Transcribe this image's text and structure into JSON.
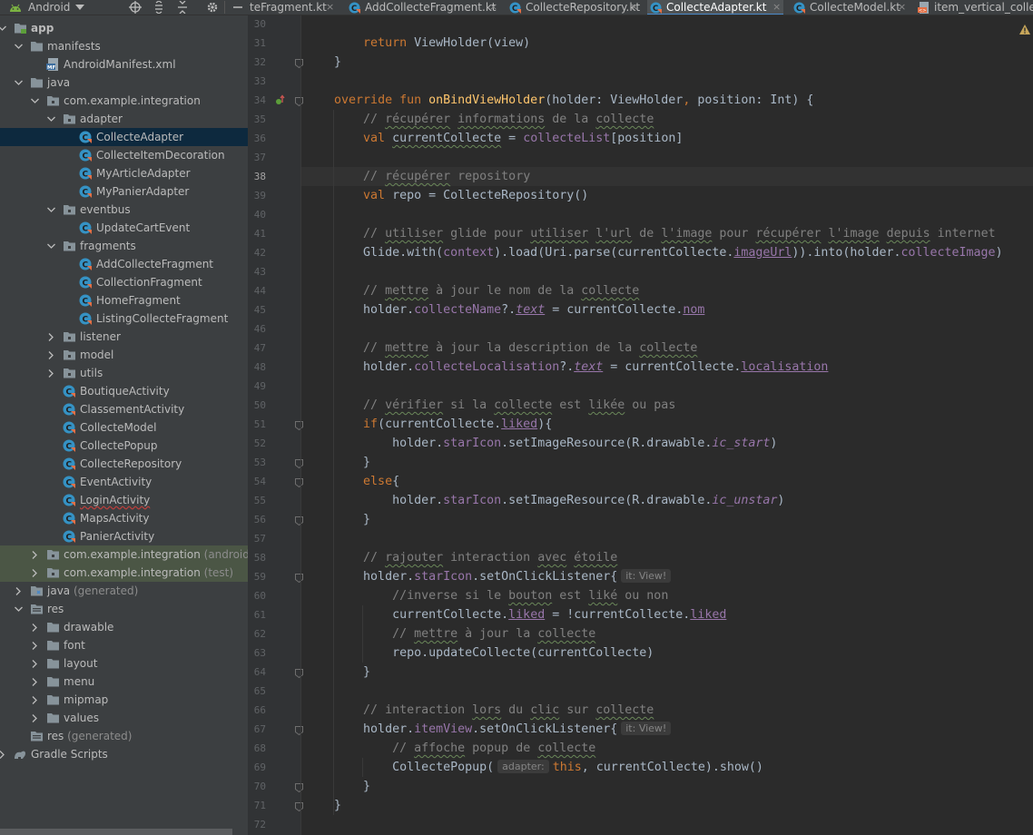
{
  "project_panel": {
    "view_mode": "Android",
    "tree": [
      {
        "label": "app",
        "depth": 0,
        "icon": "module-folder-icon",
        "expanded": true,
        "bold": true
      },
      {
        "label": "manifests",
        "depth": 1,
        "icon": "folder-icon",
        "expanded": true
      },
      {
        "label": "AndroidManifest.xml",
        "depth": 2,
        "icon": "manifest-file-icon"
      },
      {
        "label": "java",
        "depth": 1,
        "icon": "folder-icon",
        "expanded": true
      },
      {
        "label": "com.example.integration",
        "depth": 2,
        "icon": "package-icon",
        "expanded": true
      },
      {
        "label": "adapter",
        "depth": 3,
        "icon": "package-icon",
        "expanded": true
      },
      {
        "label": "CollecteAdapter",
        "depth": 4,
        "icon": "kotlin-class-icon",
        "selected": true
      },
      {
        "label": "CollecteItemDecoration",
        "depth": 4,
        "icon": "kotlin-class-icon"
      },
      {
        "label": "MyArticleAdapter",
        "depth": 4,
        "icon": "kotlin-class-icon"
      },
      {
        "label": "MyPanierAdapter",
        "depth": 4,
        "icon": "kotlin-class-icon"
      },
      {
        "label": "eventbus",
        "depth": 3,
        "icon": "package-icon",
        "expanded": true
      },
      {
        "label": "UpdateCartEvent",
        "depth": 4,
        "icon": "kotlin-class-icon"
      },
      {
        "label": "fragments",
        "depth": 3,
        "icon": "package-icon",
        "expanded": true
      },
      {
        "label": "AddCollecteFragment",
        "depth": 4,
        "icon": "kotlin-class-icon"
      },
      {
        "label": "CollectionFragment",
        "depth": 4,
        "icon": "kotlin-class-icon"
      },
      {
        "label": "HomeFragment",
        "depth": 4,
        "icon": "kotlin-class-icon"
      },
      {
        "label": "ListingCollecteFragment",
        "depth": 4,
        "icon": "kotlin-class-icon"
      },
      {
        "label": "listener",
        "depth": 3,
        "icon": "package-icon",
        "expanded": false
      },
      {
        "label": "model",
        "depth": 3,
        "icon": "package-icon",
        "expanded": false
      },
      {
        "label": "utils",
        "depth": 3,
        "icon": "package-icon",
        "expanded": false
      },
      {
        "label": "BoutiqueActivity",
        "depth": 3,
        "icon": "kotlin-class-icon"
      },
      {
        "label": "ClassementActivity",
        "depth": 3,
        "icon": "kotlin-class-icon"
      },
      {
        "label": "CollecteModel",
        "depth": 3,
        "icon": "kotlin-class-icon"
      },
      {
        "label": "CollectePopup",
        "depth": 3,
        "icon": "kotlin-class-icon"
      },
      {
        "label": "CollecteRepository",
        "depth": 3,
        "icon": "kotlin-class-icon"
      },
      {
        "label": "EventActivity",
        "depth": 3,
        "icon": "kotlin-class-icon"
      },
      {
        "label": "LoginActivity",
        "depth": 3,
        "icon": "kotlin-class-icon",
        "error": true
      },
      {
        "label": "MapsActivity",
        "depth": 3,
        "icon": "kotlin-class-icon"
      },
      {
        "label": "PanierActivity",
        "depth": 3,
        "icon": "kotlin-class-icon"
      },
      {
        "label": "com.example.integration",
        "suffix": "(androidTe",
        "depth": 2,
        "icon": "package-icon",
        "expanded": false,
        "highlight": true
      },
      {
        "label": "com.example.integration",
        "suffix": "(test)",
        "depth": 2,
        "icon": "package-icon",
        "expanded": false,
        "highlight": true
      },
      {
        "label": "java",
        "suffix": "(generated)",
        "depth": 1,
        "icon": "generated-folder-icon",
        "expanded": false
      },
      {
        "label": "res",
        "depth": 1,
        "icon": "res-folder-icon",
        "expanded": true
      },
      {
        "label": "drawable",
        "depth": 2,
        "icon": "folder-icon",
        "expanded": false
      },
      {
        "label": "font",
        "depth": 2,
        "icon": "folder-icon",
        "expanded": false
      },
      {
        "label": "layout",
        "depth": 2,
        "icon": "folder-icon",
        "expanded": false
      },
      {
        "label": "menu",
        "depth": 2,
        "icon": "folder-icon",
        "expanded": false
      },
      {
        "label": "mipmap",
        "depth": 2,
        "icon": "folder-icon",
        "expanded": false
      },
      {
        "label": "values",
        "depth": 2,
        "icon": "folder-icon",
        "expanded": false
      },
      {
        "label": "res",
        "suffix": "(generated)",
        "depth": 1,
        "icon": "res-folder-icon"
      },
      {
        "label": "Gradle Scripts",
        "depth": 0,
        "icon": "gradle-icon",
        "expanded": false
      }
    ]
  },
  "tabs": [
    {
      "label": "teFragment.kt",
      "icon": "kotlin-file-icon",
      "active": false
    },
    {
      "label": "AddCollecteFragment.kt",
      "icon": "kotlin-file-icon",
      "active": false
    },
    {
      "label": "CollecteRepository.kt",
      "icon": "kotlin-file-icon",
      "active": false
    },
    {
      "label": "CollecteAdapter.kt",
      "icon": "kotlin-file-icon",
      "active": true
    },
    {
      "label": "CollecteModel.kt",
      "icon": "kotlin-file-icon",
      "active": false
    },
    {
      "label": "item_vertical_collecte",
      "icon": "xml-file-icon",
      "active": false
    }
  ],
  "editor": {
    "current_line": 38,
    "lines": [
      {
        "n": 30,
        "tokens": []
      },
      {
        "n": 31,
        "tokens": [
          {
            "t": "        "
          },
          {
            "t": "return ",
            "c": "kw"
          },
          {
            "t": "ViewHolder(view)"
          }
        ]
      },
      {
        "n": 32,
        "tokens": [
          {
            "t": "    }"
          }
        ]
      },
      {
        "n": 33,
        "tokens": []
      },
      {
        "n": 34,
        "tokens": [
          {
            "t": "    "
          },
          {
            "t": "override fun ",
            "c": "kw"
          },
          {
            "t": "onBindViewHolder",
            "c": "fn"
          },
          {
            "t": "(holder: ViewHolder"
          },
          {
            "t": ", ",
            "c": "kw"
          },
          {
            "t": "position: Int) {"
          }
        ]
      },
      {
        "n": 35,
        "tokens": [
          {
            "t": "        "
          },
          {
            "t": "// ",
            "c": "cm"
          },
          {
            "t": "récupérer",
            "c": "cm typo"
          },
          {
            "t": " ",
            "c": "cm"
          },
          {
            "t": "informations",
            "c": "cm typo"
          },
          {
            "t": " de la ",
            "c": "cm"
          },
          {
            "t": "collecte",
            "c": "cm typo"
          }
        ]
      },
      {
        "n": 36,
        "tokens": [
          {
            "t": "        "
          },
          {
            "t": "val ",
            "c": "kw"
          },
          {
            "t": "currentCollecte",
            "c": "typo"
          },
          {
            "t": " = "
          },
          {
            "t": "collecteList",
            "c": "prop"
          },
          {
            "t": "[position]"
          }
        ]
      },
      {
        "n": 37,
        "tokens": []
      },
      {
        "n": 38,
        "tokens": [
          {
            "t": "        "
          },
          {
            "t": "// ",
            "c": "cm"
          },
          {
            "t": "récupérer",
            "c": "cm typo"
          },
          {
            "t": " repository",
            "c": "cm"
          }
        ]
      },
      {
        "n": 39,
        "tokens": [
          {
            "t": "        "
          },
          {
            "t": "val ",
            "c": "kw"
          },
          {
            "t": "repo = CollecteRepository()"
          }
        ]
      },
      {
        "n": 40,
        "tokens": []
      },
      {
        "n": 41,
        "tokens": [
          {
            "t": "        "
          },
          {
            "t": "// ",
            "c": "cm"
          },
          {
            "t": "utiliser",
            "c": "cm typo"
          },
          {
            "t": " glide pour ",
            "c": "cm"
          },
          {
            "t": "utiliser",
            "c": "cm typo"
          },
          {
            "t": " ",
            "c": "cm"
          },
          {
            "t": "l'url",
            "c": "cm typo"
          },
          {
            "t": " de ",
            "c": "cm"
          },
          {
            "t": "l'image",
            "c": "cm typo"
          },
          {
            "t": " pour ",
            "c": "cm"
          },
          {
            "t": "récupérer",
            "c": "cm typo"
          },
          {
            "t": " ",
            "c": "cm"
          },
          {
            "t": "l'image",
            "c": "cm typo"
          },
          {
            "t": " ",
            "c": "cm"
          },
          {
            "t": "depuis",
            "c": "cm typo"
          },
          {
            "t": " internet",
            "c": "cm"
          }
        ]
      },
      {
        "n": 42,
        "tokens": [
          {
            "t": "        "
          },
          {
            "t": "Glide.with("
          },
          {
            "t": "context",
            "c": "prop"
          },
          {
            "t": ").load(Uri.parse(currentCollecte."
          },
          {
            "t": "imageUrl",
            "c": "prop ul"
          },
          {
            "t": ")).into(holder."
          },
          {
            "t": "collecteImage",
            "c": "prop"
          },
          {
            "t": ")"
          }
        ]
      },
      {
        "n": 43,
        "tokens": []
      },
      {
        "n": 44,
        "tokens": [
          {
            "t": "        "
          },
          {
            "t": "// ",
            "c": "cm"
          },
          {
            "t": "mettre",
            "c": "cm typo"
          },
          {
            "t": " à jour le nom de la ",
            "c": "cm"
          },
          {
            "t": "collecte",
            "c": "cm typo"
          }
        ]
      },
      {
        "n": 45,
        "tokens": [
          {
            "t": "        "
          },
          {
            "t": "holder."
          },
          {
            "t": "collecteName",
            "c": "prop"
          },
          {
            "t": "?."
          },
          {
            "t": "text",
            "c": "prop ital ul"
          },
          {
            "t": " = currentCollecte."
          },
          {
            "t": "nom",
            "c": "prop ul"
          }
        ]
      },
      {
        "n": 46,
        "tokens": []
      },
      {
        "n": 47,
        "tokens": [
          {
            "t": "        "
          },
          {
            "t": "// ",
            "c": "cm"
          },
          {
            "t": "mettre",
            "c": "cm typo"
          },
          {
            "t": " à jour la description de la ",
            "c": "cm"
          },
          {
            "t": "collecte",
            "c": "cm typo"
          }
        ]
      },
      {
        "n": 48,
        "tokens": [
          {
            "t": "        "
          },
          {
            "t": "holder."
          },
          {
            "t": "collecteLocalisation",
            "c": "prop"
          },
          {
            "t": "?."
          },
          {
            "t": "text",
            "c": "prop ital ul"
          },
          {
            "t": " = currentCollecte."
          },
          {
            "t": "localisation",
            "c": "prop ul"
          }
        ]
      },
      {
        "n": 49,
        "tokens": []
      },
      {
        "n": 50,
        "tokens": [
          {
            "t": "        "
          },
          {
            "t": "// ",
            "c": "cm"
          },
          {
            "t": "vérifier",
            "c": "cm typo"
          },
          {
            "t": " si la ",
            "c": "cm"
          },
          {
            "t": "collecte",
            "c": "cm typo"
          },
          {
            "t": " est ",
            "c": "cm"
          },
          {
            "t": "likée",
            "c": "cm typo"
          },
          {
            "t": " ou pas",
            "c": "cm"
          }
        ]
      },
      {
        "n": 51,
        "tokens": [
          {
            "t": "        "
          },
          {
            "t": "if",
            "c": "kw"
          },
          {
            "t": "(currentCollecte."
          },
          {
            "t": "liked",
            "c": "prop ul"
          },
          {
            "t": "){"
          }
        ]
      },
      {
        "n": 52,
        "tokens": [
          {
            "t": "            "
          },
          {
            "t": "holder."
          },
          {
            "t": "starIcon",
            "c": "prop"
          },
          {
            "t": ".setImageResource(R.drawable."
          },
          {
            "t": "ic_start",
            "c": "prop ital"
          },
          {
            "t": ")"
          }
        ]
      },
      {
        "n": 53,
        "tokens": [
          {
            "t": "        }"
          }
        ]
      },
      {
        "n": 54,
        "tokens": [
          {
            "t": "        "
          },
          {
            "t": "else",
            "c": "kw"
          },
          {
            "t": "{"
          }
        ]
      },
      {
        "n": 55,
        "tokens": [
          {
            "t": "            "
          },
          {
            "t": "holder."
          },
          {
            "t": "starIcon",
            "c": "prop"
          },
          {
            "t": ".setImageResource(R.drawable."
          },
          {
            "t": "ic_unstar",
            "c": "prop ital"
          },
          {
            "t": ")"
          }
        ]
      },
      {
        "n": 56,
        "tokens": [
          {
            "t": "        }"
          }
        ]
      },
      {
        "n": 57,
        "tokens": []
      },
      {
        "n": 58,
        "tokens": [
          {
            "t": "        "
          },
          {
            "t": "// ",
            "c": "cm"
          },
          {
            "t": "rajouter",
            "c": "cm typo"
          },
          {
            "t": " interaction ",
            "c": "cm"
          },
          {
            "t": "avec",
            "c": "cm typo"
          },
          {
            "t": " ",
            "c": "cm"
          },
          {
            "t": "étoile",
            "c": "cm typo"
          }
        ]
      },
      {
        "n": 59,
        "tokens": [
          {
            "t": "        "
          },
          {
            "t": "holder."
          },
          {
            "t": "starIcon",
            "c": "prop"
          },
          {
            "t": ".setOnClickListener{"
          },
          {
            "hint": "it: View!"
          }
        ]
      },
      {
        "n": 60,
        "tokens": [
          {
            "t": "            "
          },
          {
            "t": "//inverse si le ",
            "c": "cm"
          },
          {
            "t": "bouton",
            "c": "cm typo"
          },
          {
            "t": " est ",
            "c": "cm"
          },
          {
            "t": "liké",
            "c": "cm typo"
          },
          {
            "t": " ou non",
            "c": "cm"
          }
        ]
      },
      {
        "n": 61,
        "tokens": [
          {
            "t": "            "
          },
          {
            "t": "currentCollecte."
          },
          {
            "t": "liked",
            "c": "prop ul"
          },
          {
            "t": " = !currentCollecte."
          },
          {
            "t": "liked",
            "c": "prop ul"
          }
        ]
      },
      {
        "n": 62,
        "tokens": [
          {
            "t": "            "
          },
          {
            "t": "// ",
            "c": "cm"
          },
          {
            "t": "mettre",
            "c": "cm typo"
          },
          {
            "t": " à jour la ",
            "c": "cm"
          },
          {
            "t": "collecte",
            "c": "cm typo"
          }
        ]
      },
      {
        "n": 63,
        "tokens": [
          {
            "t": "            "
          },
          {
            "t": "repo.updateCollecte(currentCollecte)"
          }
        ]
      },
      {
        "n": 64,
        "tokens": [
          {
            "t": "        }"
          }
        ]
      },
      {
        "n": 65,
        "tokens": []
      },
      {
        "n": 66,
        "tokens": [
          {
            "t": "        "
          },
          {
            "t": "// interaction ",
            "c": "cm"
          },
          {
            "t": "lors",
            "c": "cm typo"
          },
          {
            "t": " du ",
            "c": "cm"
          },
          {
            "t": "clic",
            "c": "cm typo"
          },
          {
            "t": " sur ",
            "c": "cm"
          },
          {
            "t": "collecte",
            "c": "cm typo"
          }
        ]
      },
      {
        "n": 67,
        "tokens": [
          {
            "t": "        "
          },
          {
            "t": "holder."
          },
          {
            "t": "itemView",
            "c": "prop"
          },
          {
            "t": ".setOnClickListener{"
          },
          {
            "hint": "it: View!"
          }
        ]
      },
      {
        "n": 68,
        "tokens": [
          {
            "t": "            "
          },
          {
            "t": "// ",
            "c": "cm"
          },
          {
            "t": "affoche",
            "c": "cm typo"
          },
          {
            "t": " popup de ",
            "c": "cm"
          },
          {
            "t": "collecte",
            "c": "cm typo"
          }
        ]
      },
      {
        "n": 69,
        "tokens": [
          {
            "t": "            "
          },
          {
            "t": "CollectePopup("
          },
          {
            "hint": "adapter:"
          },
          {
            "t": "this",
            "c": "kw"
          },
          {
            "t": ", currentCollecte).show()"
          }
        ]
      },
      {
        "n": 70,
        "tokens": [
          {
            "t": "        }"
          }
        ]
      },
      {
        "n": 71,
        "tokens": [
          {
            "t": "    }"
          }
        ]
      },
      {
        "n": 72,
        "tokens": []
      }
    ]
  },
  "colors": {
    "panel_bg": "#3c3f41",
    "editor_bg": "#2b2b2b",
    "selection": "#0d293e",
    "keyword": "#cc7832",
    "function": "#ffc66d",
    "property": "#9876aa",
    "comment": "#808080"
  }
}
